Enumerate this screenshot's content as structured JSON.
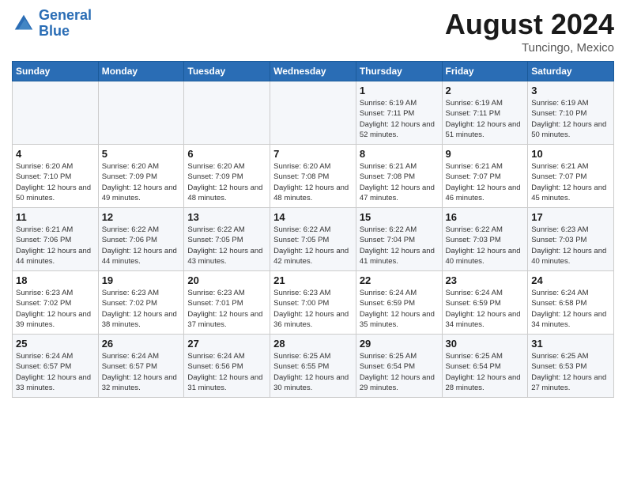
{
  "header": {
    "logo_line1": "General",
    "logo_line2": "Blue",
    "month_title": "August 2024",
    "subtitle": "Tuncingo, Mexico"
  },
  "days_of_week": [
    "Sunday",
    "Monday",
    "Tuesday",
    "Wednesday",
    "Thursday",
    "Friday",
    "Saturday"
  ],
  "weeks": [
    [
      {
        "day": "",
        "info": ""
      },
      {
        "day": "",
        "info": ""
      },
      {
        "day": "",
        "info": ""
      },
      {
        "day": "",
        "info": ""
      },
      {
        "day": "1",
        "info": "Sunrise: 6:19 AM\nSunset: 7:11 PM\nDaylight: 12 hours\nand 52 minutes."
      },
      {
        "day": "2",
        "info": "Sunrise: 6:19 AM\nSunset: 7:11 PM\nDaylight: 12 hours\nand 51 minutes."
      },
      {
        "day": "3",
        "info": "Sunrise: 6:19 AM\nSunset: 7:10 PM\nDaylight: 12 hours\nand 50 minutes."
      }
    ],
    [
      {
        "day": "4",
        "info": "Sunrise: 6:20 AM\nSunset: 7:10 PM\nDaylight: 12 hours\nand 50 minutes."
      },
      {
        "day": "5",
        "info": "Sunrise: 6:20 AM\nSunset: 7:09 PM\nDaylight: 12 hours\nand 49 minutes."
      },
      {
        "day": "6",
        "info": "Sunrise: 6:20 AM\nSunset: 7:09 PM\nDaylight: 12 hours\nand 48 minutes."
      },
      {
        "day": "7",
        "info": "Sunrise: 6:20 AM\nSunset: 7:08 PM\nDaylight: 12 hours\nand 48 minutes."
      },
      {
        "day": "8",
        "info": "Sunrise: 6:21 AM\nSunset: 7:08 PM\nDaylight: 12 hours\nand 47 minutes."
      },
      {
        "day": "9",
        "info": "Sunrise: 6:21 AM\nSunset: 7:07 PM\nDaylight: 12 hours\nand 46 minutes."
      },
      {
        "day": "10",
        "info": "Sunrise: 6:21 AM\nSunset: 7:07 PM\nDaylight: 12 hours\nand 45 minutes."
      }
    ],
    [
      {
        "day": "11",
        "info": "Sunrise: 6:21 AM\nSunset: 7:06 PM\nDaylight: 12 hours\nand 44 minutes."
      },
      {
        "day": "12",
        "info": "Sunrise: 6:22 AM\nSunset: 7:06 PM\nDaylight: 12 hours\nand 44 minutes."
      },
      {
        "day": "13",
        "info": "Sunrise: 6:22 AM\nSunset: 7:05 PM\nDaylight: 12 hours\nand 43 minutes."
      },
      {
        "day": "14",
        "info": "Sunrise: 6:22 AM\nSunset: 7:05 PM\nDaylight: 12 hours\nand 42 minutes."
      },
      {
        "day": "15",
        "info": "Sunrise: 6:22 AM\nSunset: 7:04 PM\nDaylight: 12 hours\nand 41 minutes."
      },
      {
        "day": "16",
        "info": "Sunrise: 6:22 AM\nSunset: 7:03 PM\nDaylight: 12 hours\nand 40 minutes."
      },
      {
        "day": "17",
        "info": "Sunrise: 6:23 AM\nSunset: 7:03 PM\nDaylight: 12 hours\nand 40 minutes."
      }
    ],
    [
      {
        "day": "18",
        "info": "Sunrise: 6:23 AM\nSunset: 7:02 PM\nDaylight: 12 hours\nand 39 minutes."
      },
      {
        "day": "19",
        "info": "Sunrise: 6:23 AM\nSunset: 7:02 PM\nDaylight: 12 hours\nand 38 minutes."
      },
      {
        "day": "20",
        "info": "Sunrise: 6:23 AM\nSunset: 7:01 PM\nDaylight: 12 hours\nand 37 minutes."
      },
      {
        "day": "21",
        "info": "Sunrise: 6:23 AM\nSunset: 7:00 PM\nDaylight: 12 hours\nand 36 minutes."
      },
      {
        "day": "22",
        "info": "Sunrise: 6:24 AM\nSunset: 6:59 PM\nDaylight: 12 hours\nand 35 minutes."
      },
      {
        "day": "23",
        "info": "Sunrise: 6:24 AM\nSunset: 6:59 PM\nDaylight: 12 hours\nand 34 minutes."
      },
      {
        "day": "24",
        "info": "Sunrise: 6:24 AM\nSunset: 6:58 PM\nDaylight: 12 hours\nand 34 minutes."
      }
    ],
    [
      {
        "day": "25",
        "info": "Sunrise: 6:24 AM\nSunset: 6:57 PM\nDaylight: 12 hours\nand 33 minutes."
      },
      {
        "day": "26",
        "info": "Sunrise: 6:24 AM\nSunset: 6:57 PM\nDaylight: 12 hours\nand 32 minutes."
      },
      {
        "day": "27",
        "info": "Sunrise: 6:24 AM\nSunset: 6:56 PM\nDaylight: 12 hours\nand 31 minutes."
      },
      {
        "day": "28",
        "info": "Sunrise: 6:25 AM\nSunset: 6:55 PM\nDaylight: 12 hours\nand 30 minutes."
      },
      {
        "day": "29",
        "info": "Sunrise: 6:25 AM\nSunset: 6:54 PM\nDaylight: 12 hours\nand 29 minutes."
      },
      {
        "day": "30",
        "info": "Sunrise: 6:25 AM\nSunset: 6:54 PM\nDaylight: 12 hours\nand 28 minutes."
      },
      {
        "day": "31",
        "info": "Sunrise: 6:25 AM\nSunset: 6:53 PM\nDaylight: 12 hours\nand 27 minutes."
      }
    ]
  ]
}
